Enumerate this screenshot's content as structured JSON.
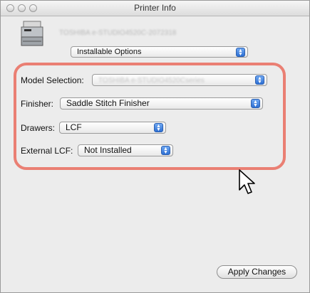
{
  "window": {
    "title": "Printer Info"
  },
  "printer": {
    "name": "TOSHIBA e-STUDIO4520C-2072318"
  },
  "section_popup": {
    "value": "Installable Options"
  },
  "options": {
    "model_selection": {
      "label": "Model Selection:",
      "value": "TOSHIBA e-STUDIO4520Cseries"
    },
    "finisher": {
      "label": "Finisher:",
      "value": "Saddle Stitch Finisher"
    },
    "drawers": {
      "label": "Drawers:",
      "value": "LCF"
    },
    "external_lcf": {
      "label": "External LCF:",
      "value": "Not Installed"
    }
  },
  "buttons": {
    "apply": "Apply Changes"
  },
  "colors": {
    "highlight_frame": "#ea7f73",
    "popup_arrow": "#2d6fd3"
  },
  "icons": [
    "printer-icon",
    "mouse-cursor-icon",
    "popup-arrows-icon"
  ]
}
